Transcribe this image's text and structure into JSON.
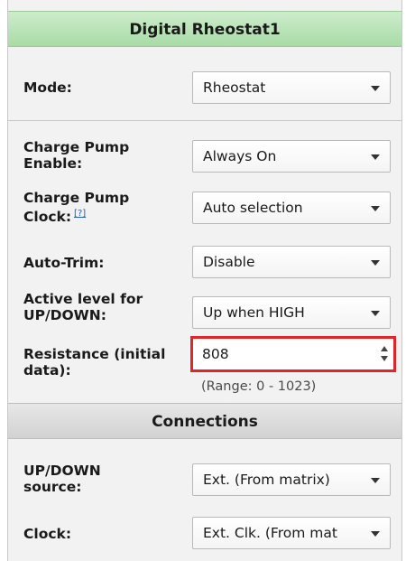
{
  "panel": {
    "title": "Digital Rheostat1",
    "connections_title": "Connections"
  },
  "fields": {
    "mode": {
      "label": "Mode:",
      "value": "Rheostat"
    },
    "charge_pump_enable": {
      "label_line1": "Charge Pump",
      "label_line2": "Enable:",
      "value": "Always On"
    },
    "charge_pump_clock": {
      "label_line1": "Charge Pump",
      "label_line2": "Clock:",
      "help": "[?]",
      "value": "Auto selection"
    },
    "auto_trim": {
      "label": "Auto-Trim:",
      "value": "Disable"
    },
    "active_level": {
      "label_line1": "Active level for",
      "label_line2": "UP/DOWN:",
      "value": "Up when HIGH"
    },
    "resistance": {
      "label_line1": "Resistance (initial",
      "label_line2": "data):",
      "value": "808",
      "range": "(Range: 0 - 1023)"
    },
    "updown_source": {
      "label_line1": "UP/DOWN",
      "label_line2": "source:",
      "value": "Ext. (From matrix)"
    },
    "clock": {
      "label": "Clock:",
      "value": "Ext. Clk. (From mat"
    }
  },
  "colors": {
    "header_green": "#a9dba6",
    "highlight_red": "#e0262b"
  }
}
